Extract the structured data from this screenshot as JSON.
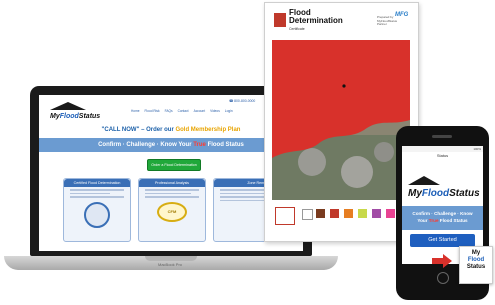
{
  "laptop": {
    "brand": "MacBook Pro",
    "site": {
      "logo_prefix": "My",
      "logo_main": "Flood",
      "logo_suffix": "Status",
      "phone": "☎ 800-800-0000",
      "nav": [
        "Home",
        "Flood Risk",
        "FAQs",
        "Contact",
        "Account",
        "Videos",
        "Login"
      ],
      "tagline_pre": "\"CALL NOW\" – Order our",
      "tagline_gold": "Gold Membership Plan",
      "banner_pre": "Confirm · Challenge · Know Your",
      "banner_red": "True",
      "banner_post": "Flood Status",
      "cta": "Order a Flood Determination",
      "cards": [
        {
          "title": "Certified Flood Determination"
        },
        {
          "title": "Professional Analysis",
          "badge": "CFM"
        },
        {
          "title": "Zone Removal"
        }
      ]
    }
  },
  "document": {
    "title_line1": "Flood",
    "title_line2": "Determination",
    "subtitle": "Certificate",
    "partner_lines": [
      "Prepared by",
      "MyFloodStatus",
      "Partner"
    ],
    "logo": "MFG"
  },
  "phone": {
    "status": "100%",
    "title": "Status",
    "logo_prefix": "My",
    "logo_main": "Flood",
    "logo_suffix": "Status",
    "banner_line1": "Confirm · Challenge · Know",
    "banner_pre": "Your",
    "banner_red": "True",
    "banner_post": "Flood Status",
    "button": "Get Started"
  },
  "mini_logo": {
    "line1": "My",
    "line2": "Flood",
    "line3": "Status"
  },
  "colors": {
    "accent_blue": "#1f5fbf",
    "flood_red": "#d8312b",
    "gold": "#e8a400",
    "cta_green": "#20a83a"
  }
}
